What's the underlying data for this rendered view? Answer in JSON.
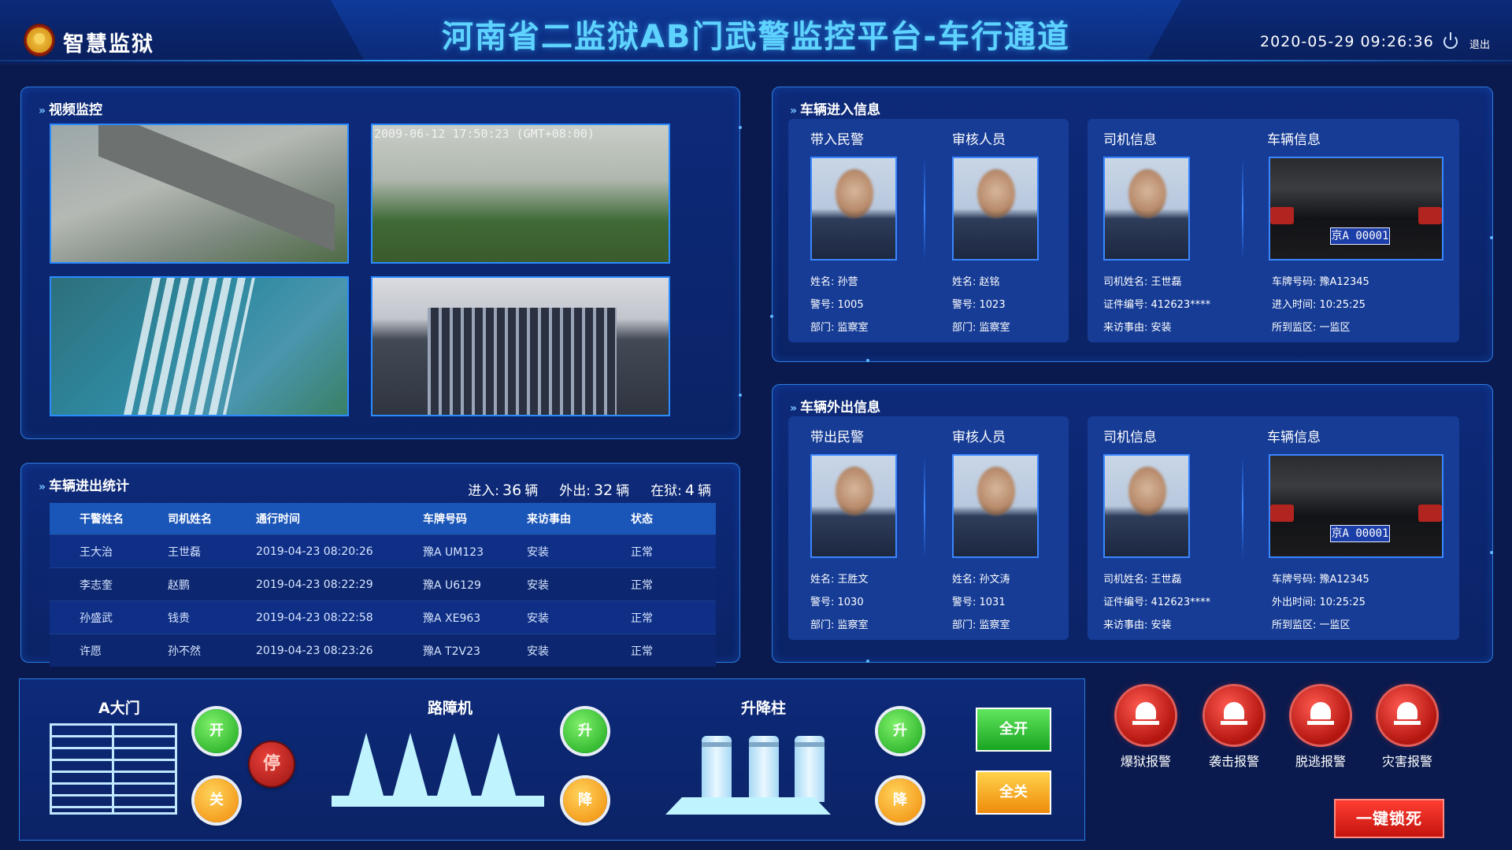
{
  "header": {
    "app_title": "智慧监狱",
    "main_title": "河南省二监狱AB门武警监控平台-车行通道",
    "datetime": "2020-05-29  09:26:36",
    "logout_label": "退出"
  },
  "video": {
    "title": "视频监控",
    "cam2_stamp": "2009-06-12 17:50:23 (GMT+08:00)"
  },
  "stats": {
    "title": "车辆进出统计",
    "in_label": "进入:",
    "in_value": "36",
    "out_label": "外出:",
    "out_value": "32",
    "inside_label": "在狱:",
    "inside_value": "4",
    "unit": "辆",
    "columns": [
      "干警姓名",
      "司机姓名",
      "通行时间",
      "车牌号码",
      "来访事由",
      "状态"
    ],
    "rows": [
      [
        "王大治",
        "王世磊",
        "2019-04-23 08:20:26",
        "豫A UM123",
        "安装",
        "正常"
      ],
      [
        "李志奎",
        "赵鹏",
        "2019-04-23 08:22:29",
        "豫A U6129",
        "安装",
        "正常"
      ],
      [
        "孙盛武",
        "钱贵",
        "2019-04-23 08:22:58",
        "豫A XE963",
        "安装",
        "正常"
      ],
      [
        "许愿",
        "孙不然",
        "2019-04-23 08:23:26",
        "豫A T2V23",
        "安装",
        "正常"
      ]
    ]
  },
  "entry": {
    "title": "车辆进入信息",
    "police_head": "带入民警",
    "reviewer_head": "审核人员",
    "driver_head": "司机信息",
    "vehicle_head": "车辆信息",
    "police": {
      "name": "姓名: 孙营",
      "badge": "警号: 1005",
      "dept": "部门: 监察室"
    },
    "reviewer": {
      "name": "姓名: 赵铭",
      "badge": "警号: 1023",
      "dept": "部门: 监察室"
    },
    "driver": {
      "name": "司机姓名: 王世磊",
      "id": "证件编号: 412623****",
      "reason": "来访事由: 安装"
    },
    "vehicle": {
      "plate": "车牌号码: 豫A12345",
      "time": "进入时间:  10:25:25",
      "area": "所到监区: 一监区",
      "plate_text": "京A 00001"
    }
  },
  "exit": {
    "title": "车辆外出信息",
    "police_head": "带出民警",
    "reviewer_head": "审核人员",
    "driver_head": "司机信息",
    "vehicle_head": "车辆信息",
    "police": {
      "name": "姓名: 王胜文",
      "badge": "警号: 1030",
      "dept": "部门: 监察室"
    },
    "reviewer": {
      "name": "姓名: 孙文涛",
      "badge": "警号: 1031",
      "dept": "部门: 监察室"
    },
    "driver": {
      "name": "司机姓名: 王世磊",
      "id": "证件编号: 412623****",
      "reason": "来访事由: 安装"
    },
    "vehicle": {
      "plate": "车牌号码: 豫A12345",
      "time": "外出时间:  10:25:25",
      "area": "所到监区: 一监区",
      "plate_text": "京A 00001"
    }
  },
  "controls": {
    "gate_label": "A大门",
    "open": "开",
    "close": "关",
    "stop": "停",
    "barrier_label": "路障机",
    "bollard_label": "升降柱",
    "up": "升",
    "down": "降",
    "all_open": "全开",
    "all_close": "全关"
  },
  "alarms": {
    "breakout": "爆狱报警",
    "attack": "袭击报警",
    "escape": "脱逃报警",
    "disaster": "灾害报警",
    "lockdown": "一键锁死"
  }
}
